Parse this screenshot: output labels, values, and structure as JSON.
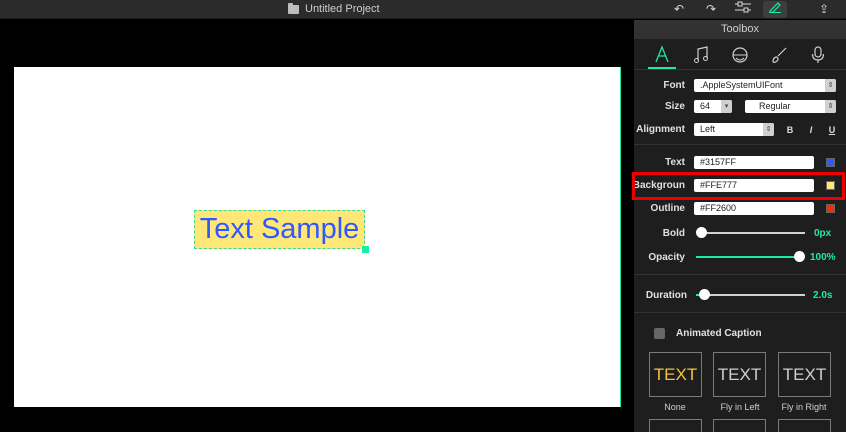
{
  "window": {
    "title": "Untitled Project",
    "toolbar_icons": [
      "undo-icon",
      "redo-icon",
      "adjust-icon",
      "pen-icon",
      "share-icon"
    ],
    "undo": "↶",
    "redo": "↷",
    "share": "⇪"
  },
  "canvas": {
    "text": "Text Sample",
    "text_color": "#3157FF",
    "background_color": "#FFE777"
  },
  "toolbox": {
    "title": "Toolbox",
    "tabs": [
      {
        "name": "text",
        "icon": "A"
      },
      {
        "name": "music",
        "icon": "♫"
      },
      {
        "name": "sticker",
        "icon": "◍"
      },
      {
        "name": "filter",
        "icon": "✎"
      },
      {
        "name": "voice",
        "icon": "🎙"
      }
    ],
    "font": {
      "label": "Font",
      "value": ".AppleSystemUIFont"
    },
    "size": {
      "label": "Size",
      "value": "64",
      "weight": "Regular"
    },
    "alignment": {
      "label": "Alignment",
      "value": "Left",
      "bold": "B",
      "italic": "I",
      "underline": "U"
    },
    "text": {
      "label": "Text",
      "value": "#3157FF",
      "color": "#3157FF"
    },
    "background": {
      "label": "Backgroun",
      "value": "#FFE777",
      "color": "#FFE777"
    },
    "outline": {
      "label": "Outline",
      "value": "#FF2600",
      "color": "#FF2600"
    },
    "bold": {
      "label": "Bold",
      "value": "0px",
      "level": 0
    },
    "opacity": {
      "label": "Opacity",
      "value": "100%",
      "level": 1
    },
    "duration": {
      "label": "Duration",
      "value": "2.0s"
    },
    "animated_caption": {
      "label": "Animated Caption",
      "checked": false
    },
    "animations": [
      {
        "preview": "TEXT",
        "label": "None",
        "color": "#F5C242"
      },
      {
        "preview": "TEXT",
        "label": "Fly in Left",
        "color": "#cfcfcf"
      },
      {
        "preview": "TEXT",
        "label": "Fly in Right",
        "color": "#cfcfcf"
      }
    ]
  }
}
